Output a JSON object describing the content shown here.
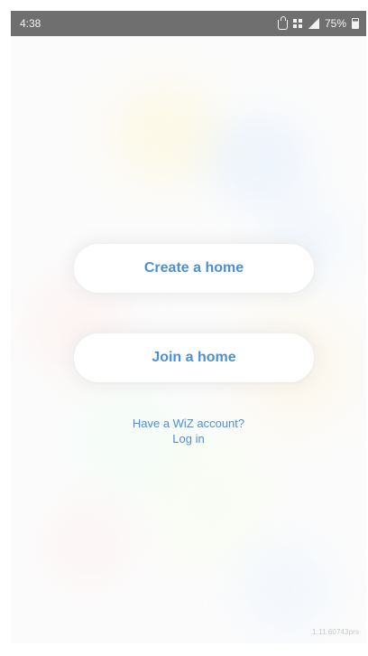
{
  "status_bar": {
    "time": "4:38",
    "battery_text": "75%"
  },
  "actions": {
    "create_home_label": "Create a home",
    "join_home_label": "Join a home"
  },
  "account": {
    "prompt": "Have a WiZ account?",
    "login_label": "Log in"
  },
  "footer": {
    "version": "1.11.60743prs"
  },
  "colors": {
    "primary_text": "#4c90d2",
    "status_bar": "#6f6f6f",
    "background": "#fbfbfb"
  },
  "icons": {
    "status": [
      "shopping-bag-icon",
      "app-grid-icon",
      "signal-icon",
      "battery-icon"
    ]
  }
}
